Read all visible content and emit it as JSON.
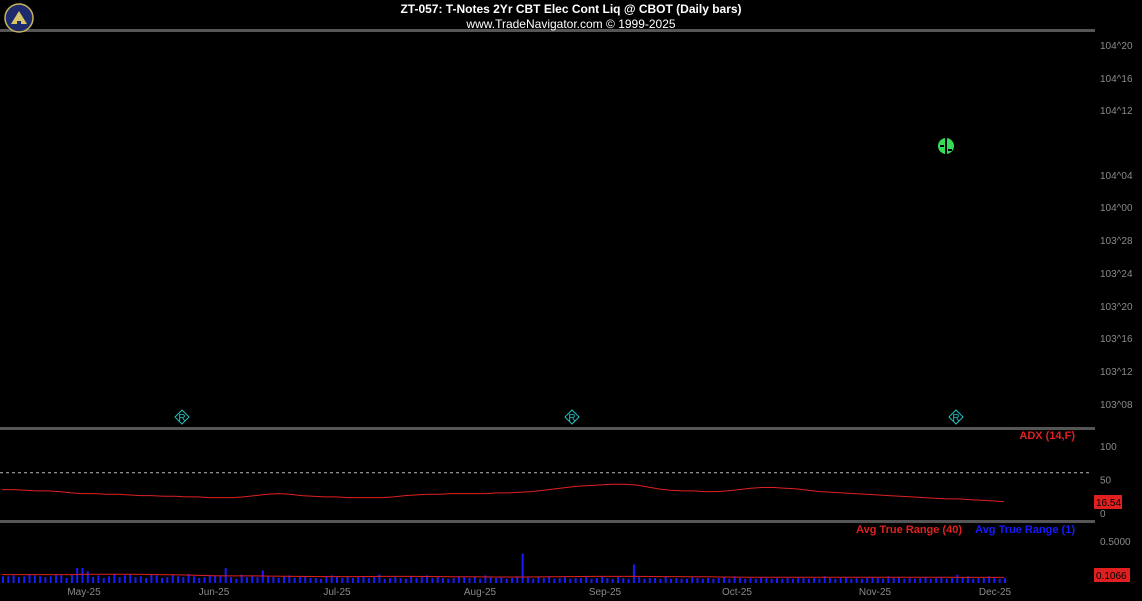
{
  "header": {
    "title": "ZT-057:  T-Notes 2Yr CBT Elec Cont Liq @ CBOT  (Daily bars)",
    "subtitle": "www.TradeNavigator.com © 1999-2025"
  },
  "colors": {
    "background": "#000000",
    "adx": "#e02020",
    "atr40": "#e02020",
    "atr1": "#1a1aff",
    "price_marker": "#33dd55",
    "r_marker": "#20c0c0",
    "axis_text": "#8a8a8a",
    "separator": "#555555"
  },
  "chart_data": [
    {
      "type": "line",
      "panel": "price",
      "y_ticks": [
        "104^20",
        "104^16",
        "104^12",
        "104^04",
        "104^00",
        "103^28",
        "103^24",
        "103^20",
        "103^16",
        "103^12",
        "103^08"
      ],
      "price_marker": {
        "month": "Nov-25",
        "value": "104^08"
      },
      "r_markers": [
        "Jun-25",
        "Sep-25",
        "Nov-25"
      ],
      "r_label": "R"
    },
    {
      "type": "line",
      "panel": "indicator",
      "series": [
        {
          "name": "ADX (14,F)"
        }
      ],
      "y_ticks": [
        "100",
        "50",
        "0"
      ],
      "reference_line": 60,
      "last_value_label": "16.54",
      "values": [
        35,
        35,
        34,
        33,
        33,
        32,
        30,
        29,
        29,
        28,
        28,
        27,
        26,
        26,
        25,
        25,
        24,
        24,
        23,
        23,
        23,
        24,
        26,
        28,
        29,
        28,
        26,
        25,
        24,
        24,
        23,
        23,
        23,
        23,
        24,
        26,
        27,
        28,
        28,
        29,
        29,
        29,
        29,
        30,
        30,
        31,
        32,
        34,
        36,
        38,
        40,
        41,
        42,
        43,
        43,
        42,
        39,
        36,
        34,
        33,
        33,
        32,
        32,
        33,
        35,
        37,
        38,
        38,
        37,
        36,
        34,
        32,
        31,
        30,
        29,
        28,
        27,
        26,
        25,
        24,
        23,
        22,
        21,
        21,
        20,
        19,
        18,
        17
      ]
    },
    {
      "type": "bar",
      "panel": "atr",
      "series": [
        {
          "name": "Avg True Range (40)",
          "kind": "line",
          "values": [
            0.1,
            0.1,
            0.1,
            0.1,
            0.1,
            0.1,
            0.105,
            0.105,
            0.105,
            0.105,
            0.102,
            0.1,
            0.098,
            0.095,
            0.09,
            0.087,
            0.085,
            0.085,
            0.085,
            0.082,
            0.08,
            0.078,
            0.077,
            0.076,
            0.076,
            0.076,
            0.077,
            0.078,
            0.078,
            0.078,
            0.077,
            0.076,
            0.075,
            0.074,
            0.073,
            0.072,
            0.072,
            0.072,
            0.073,
            0.075,
            0.076,
            0.077,
            0.078,
            0.078,
            0.078,
            0.078,
            0.077,
            0.076,
            0.076,
            0.075,
            0.074,
            0.072,
            0.07,
            0.068,
            0.068,
            0.068,
            0.068,
            0.068,
            0.068,
            0.068,
            0.068,
            0.068,
            0.068,
            0.068,
            0.068,
            0.068,
            0.068,
            0.068,
            0.067,
            0.067,
            0.067,
            0.067
          ]
        },
        {
          "name": "Avg True Range (1)",
          "kind": "bar",
          "values": [
            0.08,
            0.08,
            0.09,
            0.07,
            0.08,
            0.1,
            0.09,
            0.08,
            0.07,
            0.08,
            0.1,
            0.09,
            0.06,
            0.1,
            0.18,
            0.18,
            0.14,
            0.07,
            0.09,
            0.06,
            0.08,
            0.11,
            0.07,
            0.09,
            0.1,
            0.07,
            0.08,
            0.06,
            0.1,
            0.09,
            0.06,
            0.07,
            0.1,
            0.08,
            0.07,
            0.11,
            0.08,
            0.06,
            0.07,
            0.09,
            0.09,
            0.09,
            0.18,
            0.07,
            0.05,
            0.1,
            0.07,
            0.09,
            0.07,
            0.15,
            0.08,
            0.07,
            0.06,
            0.08,
            0.09,
            0.06,
            0.07,
            0.08,
            0.06,
            0.06,
            0.05,
            0.07,
            0.09,
            0.07,
            0.06,
            0.07,
            0.06,
            0.07,
            0.08,
            0.06,
            0.07,
            0.1,
            0.05,
            0.06,
            0.07,
            0.06,
            0.05,
            0.08,
            0.06,
            0.07,
            0.09,
            0.06,
            0.07,
            0.06,
            0.05,
            0.06,
            0.08,
            0.07,
            0.06,
            0.08,
            0.05,
            0.09,
            0.07,
            0.06,
            0.07,
            0.05,
            0.06,
            0.08,
            0.35,
            0.07,
            0.05,
            0.07,
            0.06,
            0.08,
            0.05,
            0.06,
            0.07,
            0.05,
            0.06,
            0.06,
            0.07,
            0.05,
            0.06,
            0.08,
            0.06,
            0.05,
            0.07,
            0.06,
            0.05,
            0.22,
            0.07,
            0.05,
            0.06,
            0.06,
            0.05,
            0.07,
            0.05,
            0.06,
            0.05,
            0.05,
            0.07,
            0.06,
            0.05,
            0.06,
            0.05,
            0.06,
            0.07,
            0.05,
            0.08,
            0.06,
            0.05,
            0.06,
            0.05,
            0.07,
            0.06,
            0.05,
            0.06,
            0.05,
            0.06,
            0.05,
            0.07,
            0.06,
            0.05,
            0.06,
            0.05,
            0.08,
            0.06,
            0.05,
            0.06,
            0.07,
            0.05,
            0.06,
            0.05,
            0.06,
            0.07,
            0.06,
            0.05,
            0.08,
            0.06,
            0.07,
            0.05,
            0.06,
            0.05,
            0.06,
            0.07,
            0.05,
            0.06,
            0.07,
            0.05,
            0.06,
            0.1,
            0.07,
            0.08,
            0.05,
            0.06,
            0.06,
            0.08,
            0.07,
            0.05,
            0.06
          ]
        }
      ],
      "y_ticks": [
        "0.5000"
      ],
      "last_value_label": "0.1066"
    }
  ],
  "x_axis": {
    "labels": [
      "May-25",
      "Jun-25",
      "Jul-25",
      "Aug-25",
      "Sep-25",
      "Oct-25",
      "Nov-25",
      "Dec-25"
    ]
  }
}
